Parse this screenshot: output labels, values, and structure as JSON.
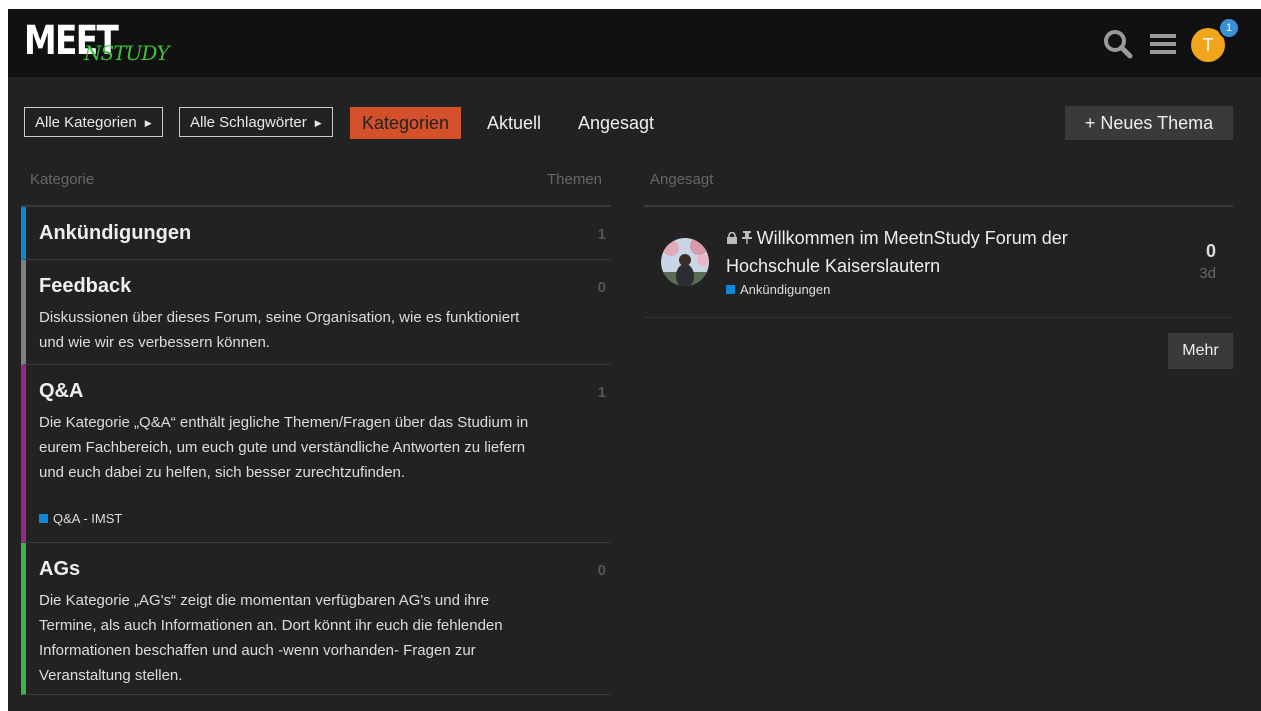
{
  "header": {
    "logo_main": "MEET",
    "logo_sub": "NSTUDY",
    "search_icon": "search-icon",
    "menu_icon": "hamburger-menu-icon",
    "avatar_letter": "T",
    "notification_count": "1"
  },
  "nav": {
    "all_categories": "Alle Kategorien",
    "all_tags": "Alle Schlagwörter",
    "tabs": [
      {
        "label": "Kategorien",
        "active": true
      },
      {
        "label": "Aktuell",
        "active": false
      },
      {
        "label": "Angesagt",
        "active": false
      }
    ],
    "new_topic": "Neues Thema"
  },
  "categories": {
    "header_category": "Kategorie",
    "header_topics": "Themen",
    "items": [
      {
        "name": "Ankündigungen",
        "count": "1",
        "color": "#0e88d4",
        "description": ""
      },
      {
        "name": "Feedback",
        "count": "0",
        "color": "#808281",
        "description": "Diskussionen über dieses Forum, seine Organisation, wie es funktioniert und wie wir es verbessern können."
      },
      {
        "name": "Q&A",
        "count": "1",
        "color": "#92278f",
        "description": "Die Kategorie „Q&A“ enthält jegliche Themen/Fragen über das Studium in eurem Fachbereich, um euch gute und verständliche Antworten zu liefern und euch dabei zu helfen, sich besser zurechtzufinden.",
        "subcategory": "Q&A - IMST",
        "subcategory_color": "#0e88d4"
      },
      {
        "name": "AGs",
        "count": "0",
        "color": "#3ab54a",
        "description": "Die Kategorie „AG's“ zeigt die momentan verfügbaren AG's und ihre Termine, als auch Informationen an. Dort könnt ihr euch die fehlenden Informationen beschaffen und auch -wenn vorhanden- Fragen zur Veranstaltung stellen."
      }
    ]
  },
  "trending": {
    "header": "Angesagt",
    "topics": [
      {
        "title": "Willkommen im MeetnStudy Forum der Hochschule Kaiserslautern",
        "category": "Ankündigungen",
        "category_color": "#0e88d4",
        "posts": "0",
        "age": "3d",
        "icons": [
          "lock-icon",
          "pin-icon"
        ]
      }
    ],
    "more": "Mehr"
  }
}
